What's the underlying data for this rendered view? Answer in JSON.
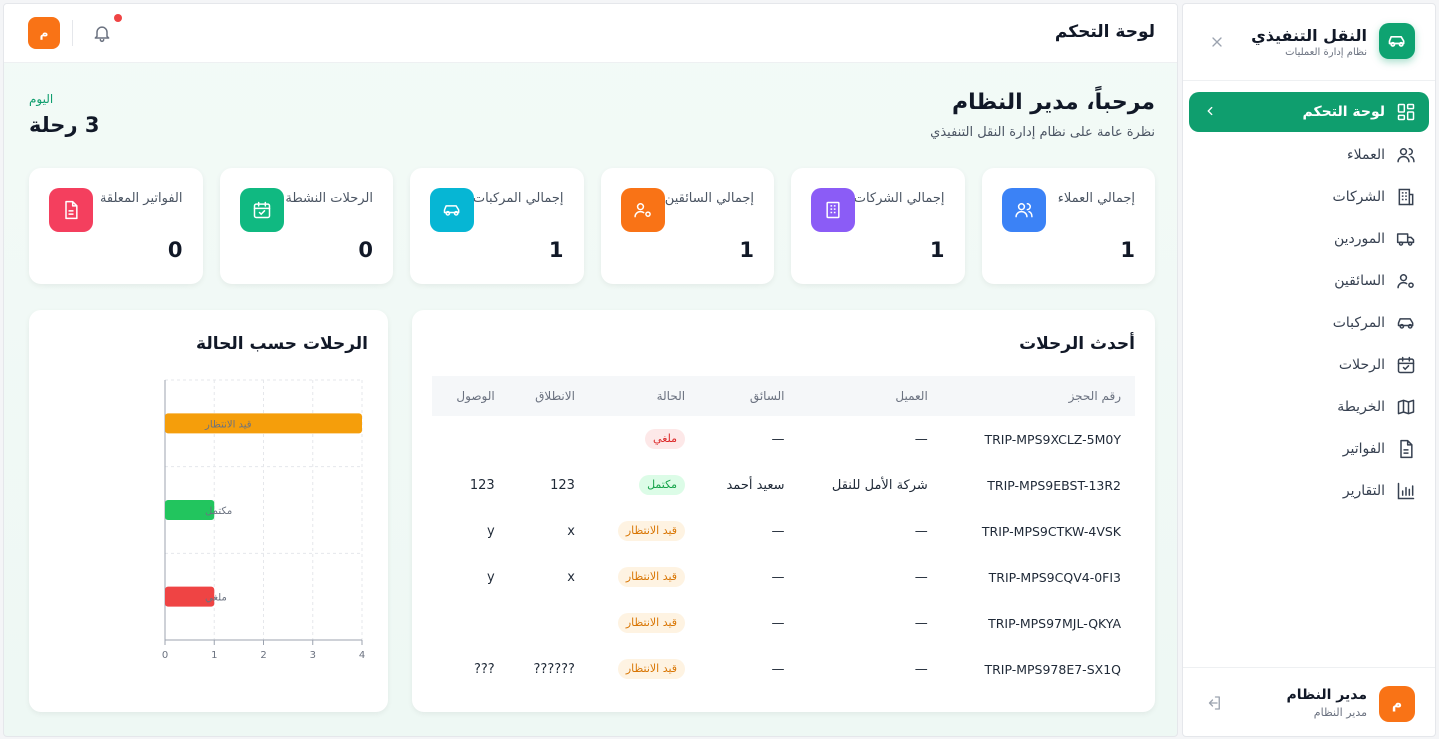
{
  "sidebar": {
    "brand_title": "النقل التنفيذي",
    "brand_subtitle": "نظام إدارة العمليات",
    "items": [
      {
        "label": "لوحة التحكم",
        "icon": "dashboard-icon",
        "active": true
      },
      {
        "label": "العملاء",
        "icon": "users-icon"
      },
      {
        "label": "الشركات",
        "icon": "building-icon"
      },
      {
        "label": "الموردين",
        "icon": "truck-icon"
      },
      {
        "label": "السائقين",
        "icon": "user-gear-icon"
      },
      {
        "label": "المركبات",
        "icon": "car-icon"
      },
      {
        "label": "الرحلات",
        "icon": "calendar-check-icon"
      },
      {
        "label": "الخريطة",
        "icon": "map-icon"
      },
      {
        "label": "الفواتير",
        "icon": "file-icon"
      },
      {
        "label": "التقارير",
        "icon": "bar-chart-icon"
      }
    ],
    "user": {
      "avatar": "م",
      "name": "مدير النظام",
      "role": "مدير النظام"
    }
  },
  "topbar": {
    "title": "لوحة التحكم",
    "avatar": "م"
  },
  "welcome": {
    "title": "مرحباً، مدير النظام",
    "subtitle": "نظرة عامة على نظام إدارة النقل التنفيذي"
  },
  "today": {
    "label": "اليوم",
    "value": "3 رحلة"
  },
  "stats": [
    {
      "label": "إجمالي العملاء",
      "value": "1",
      "color": "#3b82f6",
      "icon": "users-icon"
    },
    {
      "label": "إجمالي الشركات",
      "value": "1",
      "color": "#8b5cf6",
      "icon": "building-icon"
    },
    {
      "label": "إجمالي السائقين",
      "value": "1",
      "color": "#f97316",
      "icon": "user-gear-icon"
    },
    {
      "label": "إجمالي المركبات",
      "value": "1",
      "color": "#06b6d4",
      "icon": "car-icon"
    },
    {
      "label": "الرحلات النشطة",
      "value": "0",
      "color": "#10b981",
      "icon": "calendar-check-icon"
    },
    {
      "label": "الفواتير المعلقة",
      "value": "0",
      "color": "#f43f5e",
      "icon": "file-icon"
    }
  ],
  "trips": {
    "title": "أحدث الرحلات",
    "columns": [
      "رقم الحجز",
      "العميل",
      "السائق",
      "الحالة",
      "الانطلاق",
      "الوصول"
    ],
    "rows": [
      {
        "id": "TRIP-MPS9XCLZ-5M0Y",
        "client": "—",
        "driver": "—",
        "status": "ملغي",
        "status_type": "cancelled",
        "from": "",
        "to": ""
      },
      {
        "id": "TRIP-MPS9EBST-13R2",
        "client": "شركة الأمل للنقل",
        "driver": "سعيد أحمد",
        "status": "مكتمل",
        "status_type": "completed",
        "from": "123",
        "to": "123"
      },
      {
        "id": "TRIP-MPS9CTKW-4VSK",
        "client": "—",
        "driver": "—",
        "status": "قيد الانتظار",
        "status_type": "pending",
        "from": "x",
        "to": "y"
      },
      {
        "id": "TRIP-MPS9CQV4-0FI3",
        "client": "—",
        "driver": "—",
        "status": "قيد الانتظار",
        "status_type": "pending",
        "from": "x",
        "to": "y"
      },
      {
        "id": "TRIP-MPS97MJL-QKYA",
        "client": "—",
        "driver": "—",
        "status": "قيد الانتظار",
        "status_type": "pending",
        "from": "",
        "to": ""
      },
      {
        "id": "TRIP-MPS978E7-SX1Q",
        "client": "—",
        "driver": "—",
        "status": "قيد الانتظار",
        "status_type": "pending",
        "from": "??????",
        "to": "???"
      }
    ]
  },
  "badge_colors": {
    "cancelled": {
      "bg": "#fde8e8",
      "fg": "#dc2626"
    },
    "completed": {
      "bg": "#dcfce7",
      "fg": "#16a34a"
    },
    "pending": {
      "bg": "#fef3e2",
      "fg": "#d97706"
    }
  },
  "chart_data": {
    "type": "bar",
    "orientation": "horizontal",
    "title": "الرحلات حسب الحالة",
    "categories": [
      "قيد الانتظار",
      "مكتمل",
      "ملغي"
    ],
    "values": [
      4,
      1,
      1
    ],
    "colors": [
      "#f59e0b",
      "#22c55e",
      "#ef4444"
    ],
    "xlim": [
      0,
      4
    ],
    "xticks": [
      0,
      1,
      2,
      3,
      4
    ],
    "grid": true
  }
}
